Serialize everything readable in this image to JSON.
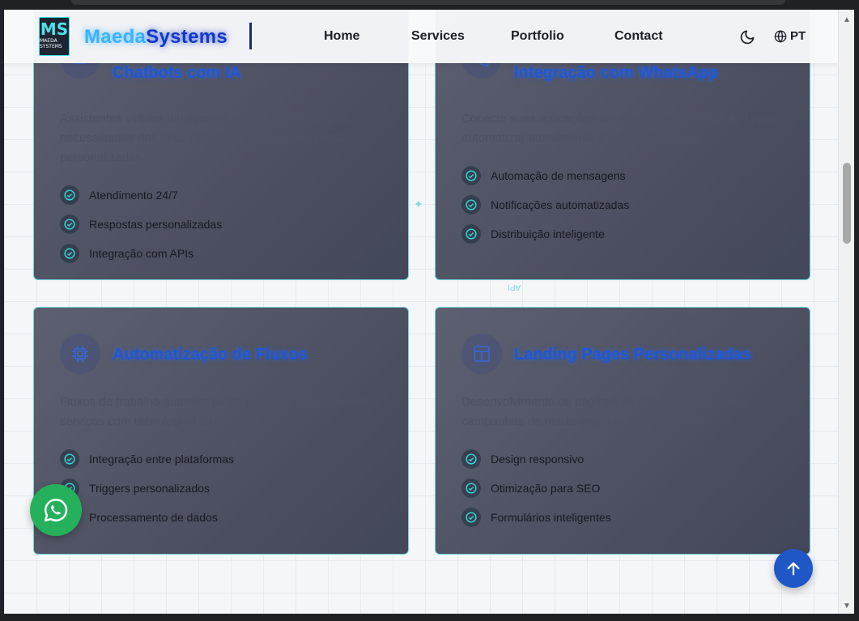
{
  "header": {
    "logo": {
      "mark": "MS",
      "subtext": "MAEDA SYSTEMS"
    },
    "brand_part1": "Maeda",
    "brand_part2": "Systems",
    "nav": [
      "Home",
      "Services",
      "Portfolio",
      "Contact"
    ],
    "lang": "PT",
    "icons": {
      "theme": "moon-icon",
      "lang": "globe-icon"
    }
  },
  "decorations": {
    "api_label": "API"
  },
  "cards": [
    {
      "title": "Chatbots com IA",
      "desc": "Assistentes virtuais inteligentes que compreendem as necessidades dos seus clientes e oferecem respostas personalizadas.",
      "features": [
        "Atendimento 24/7",
        "Respostas personalizadas",
        "Integração com APIs"
      ]
    },
    {
      "title": "Integração com WhatsApp",
      "desc": "Conecte suas aplicações ao WhatsApp Business API para automatizar atendimento e marketing digital.",
      "features": [
        "Automação de mensagens",
        "Notificações automatizadas",
        "Distribuição inteligente"
      ]
    },
    {
      "title": "Automatização de Fluxos",
      "desc": "Fluxos de trabalho automatizados que conectam diferentes serviços com tecnologia N8N.",
      "features": [
        "Integração entre plataformas",
        "Triggers personalizados",
        "Processamento de dados"
      ]
    },
    {
      "title": "Landing Pages Personalizadas",
      "desc": "Desenvolvimento de páginas de alta conversão para campanhas de marketing com design futurista.",
      "features": [
        "Design responsivo",
        "Otimização para SEO",
        "Formulários inteligentes"
      ]
    }
  ],
  "colors": {
    "accent": "#1f57d6",
    "teal": "#38d3d8",
    "whatsapp": "#25b05b",
    "scroll_top": "#1f57c7"
  }
}
